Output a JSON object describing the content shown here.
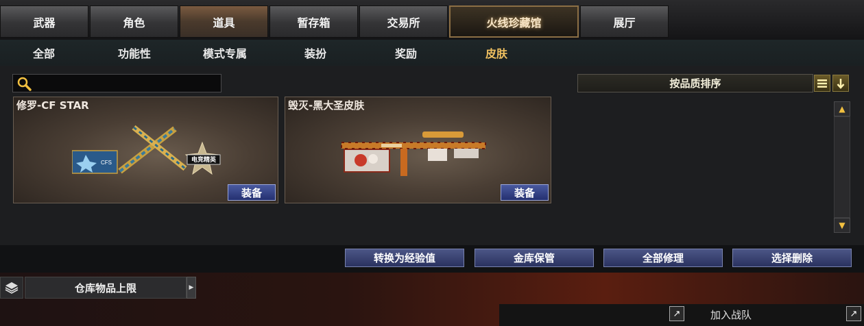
{
  "top_tabs": [
    {
      "label": "武器"
    },
    {
      "label": "角色"
    },
    {
      "label": "道具"
    },
    {
      "label": "暂存箱"
    },
    {
      "label": "交易所"
    },
    {
      "label": "火线珍藏馆"
    },
    {
      "label": "展厅"
    }
  ],
  "active_top_tab": "道具",
  "sub_tabs": [
    {
      "label": "全部"
    },
    {
      "label": "功能性"
    },
    {
      "label": "模式专属"
    },
    {
      "label": "装扮"
    },
    {
      "label": "奖励"
    },
    {
      "label": "皮肤"
    }
  ],
  "active_sub_tab": "皮肤",
  "search": {
    "value": "",
    "placeholder": "",
    "icon": "search-icon"
  },
  "sort": {
    "label": "按品质排序",
    "icons": [
      "list-icon",
      "arrow-down-icon"
    ]
  },
  "items": [
    {
      "name": "修罗-CF STAR",
      "button": "装备",
      "badges": [
        "CFS",
        "电竞精英"
      ]
    },
    {
      "name": "毁灭-黑大圣皮肤",
      "button": "装备"
    }
  ],
  "footer_buttons": [
    {
      "label": "转换为经验值"
    },
    {
      "label": "金库保管"
    },
    {
      "label": "全部修理"
    },
    {
      "label": "选择删除"
    }
  ],
  "storage": {
    "label": "仓库物品上限",
    "icon": "layers-icon"
  },
  "join": {
    "label": "加入战队",
    "icons": [
      "expand-icon",
      "expand-icon"
    ]
  },
  "colors": {
    "active_sub_tab": "#f0c060",
    "equip_button": "#2f3a7a",
    "scroll_arrow": "#f2c040"
  }
}
